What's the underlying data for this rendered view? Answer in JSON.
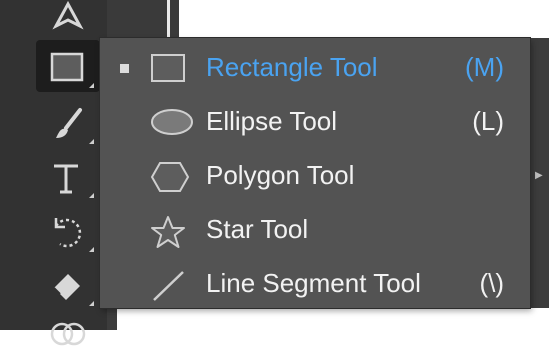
{
  "flyout": {
    "items": [
      {
        "icon": "rectangle-icon",
        "label": "Rectangle Tool",
        "shortcut": "(M)",
        "selected": true
      },
      {
        "icon": "ellipse-icon",
        "label": "Ellipse Tool",
        "shortcut": "(L)",
        "selected": false
      },
      {
        "icon": "polygon-icon",
        "label": "Polygon Tool",
        "shortcut": "",
        "selected": false
      },
      {
        "icon": "star-icon",
        "label": "Star Tool",
        "shortcut": "",
        "selected": false
      },
      {
        "icon": "line-segment-icon",
        "label": "Line Segment Tool",
        "shortcut": "(\\)",
        "selected": false
      }
    ]
  },
  "toolbar": {
    "tools": [
      {
        "icon": "pen-icon"
      },
      {
        "icon": "rectangle-icon",
        "active": true
      },
      {
        "icon": "paintbrush-icon"
      },
      {
        "icon": "type-icon"
      },
      {
        "icon": "rotate-icon"
      },
      {
        "icon": "eraser-icon"
      },
      {
        "icon": "shape-builder-icon"
      }
    ]
  },
  "colors": {
    "menu_bg": "#535353",
    "selected_text": "#4aa3f1",
    "toolbar_bg": "#323232"
  }
}
